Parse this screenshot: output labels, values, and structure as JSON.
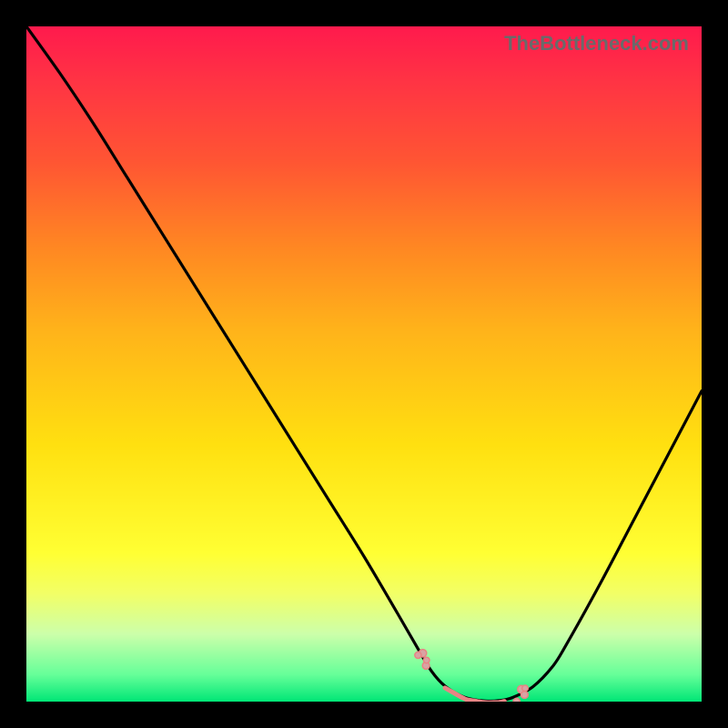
{
  "watermark": "TheBottleneck.com",
  "colors": {
    "frame": "#000000",
    "curve": "#000000",
    "dots": "#e88484",
    "dot_fill": "#d9a3a3"
  },
  "chart_data": {
    "type": "line",
    "title": "",
    "xlabel": "",
    "ylabel": "",
    "xlim": [
      0,
      100
    ],
    "ylim": [
      0,
      100
    ],
    "series": [
      {
        "name": "bottleneck-curve",
        "x": [
          0,
          5,
          10,
          15,
          20,
          25,
          30,
          35,
          40,
          45,
          50,
          55,
          58,
          60,
          62,
          65,
          68,
          70,
          72,
          75,
          78,
          80,
          85,
          90,
          95,
          100
        ],
        "y": [
          100,
          93,
          85.5,
          77.5,
          69.5,
          61.5,
          53.5,
          45.5,
          37.5,
          29.5,
          21.5,
          13,
          7.8,
          4.5,
          2.3,
          0.6,
          0.1,
          0.15,
          0.6,
          2.2,
          5.3,
          8.5,
          17.5,
          27,
          36.5,
          46
        ]
      }
    ],
    "annotations": {
      "left_dot_cluster_x_range": [
        58,
        60
      ],
      "right_dot_cluster_x_range": [
        72.5,
        74.5
      ],
      "plateau_x_range": [
        62,
        71
      ]
    }
  }
}
